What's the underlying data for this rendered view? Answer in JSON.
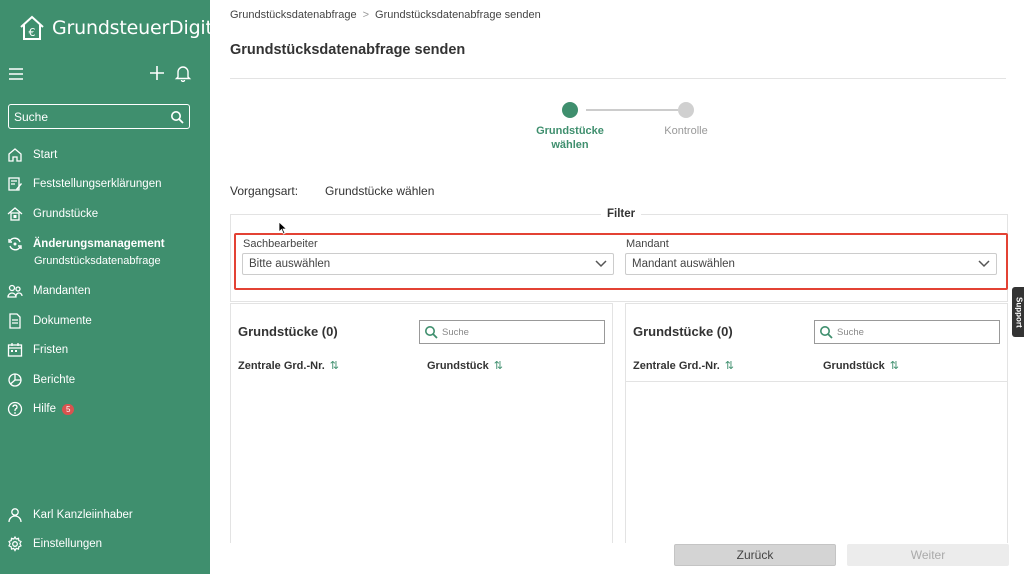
{
  "app": {
    "logo_text": "GrundsteuerDigital"
  },
  "sidebar": {
    "search_label": "Suche",
    "items": [
      {
        "label": "Start",
        "icon": "home-icon"
      },
      {
        "label": "Feststellungserklärungen",
        "icon": "edit-document-icon"
      },
      {
        "label": "Grundstücke",
        "icon": "house-icon"
      },
      {
        "label": "Änderungsmanagement",
        "icon": "refresh-icon",
        "active": true
      },
      {
        "label": "Grundstücksdatenabfrage",
        "sub": true
      },
      {
        "label": "Mandanten",
        "icon": "people-icon"
      },
      {
        "label": "Dokumente",
        "icon": "document-icon"
      },
      {
        "label": "Fristen",
        "icon": "calendar-icon"
      },
      {
        "label": "Berichte",
        "icon": "pie-chart-icon"
      },
      {
        "label": "Hilfe",
        "icon": "help-icon",
        "badge": "5"
      }
    ],
    "user": "Karl Kanzleiinhaber",
    "settings": "Einstellungen"
  },
  "breadcrumb": {
    "parent": "Grundstücksdatenabfrage",
    "separator": ">",
    "current": "Grundstücksdatenabfrage senden"
  },
  "page_title": "Grundstücksdatenabfrage senden",
  "stepper": {
    "step1_line1": "Grundstücke",
    "step1_line2": "wählen",
    "step2": "Kontrolle",
    "active_color": "#3f8f6e",
    "inactive_color": "#cccccc"
  },
  "vorgangsart": {
    "label": "Vorgangsart:",
    "value": "Grundstücke wählen"
  },
  "filter": {
    "title": "Filter",
    "sachbearbeiter_label": "Sachbearbeiter",
    "sachbearbeiter_value": "Bitte auswählen",
    "mandant_label": "Mandant",
    "mandant_value": "Mandant auswählen"
  },
  "panels": {
    "left": {
      "title": "Grundstücke (0)",
      "search_placeholder": "Suche",
      "col1": "Zentrale Grd.-Nr.",
      "col2": "Grundstück"
    },
    "right": {
      "title": "Grundstücke (0)",
      "search_placeholder": "Suche",
      "col1": "Zentrale Grd.-Nr.",
      "col2": "Grundstück"
    }
  },
  "buttons": {
    "back": "Zurück",
    "next": "Weiter"
  },
  "support": "Support",
  "colors": {
    "brand": "#3f8f6e",
    "highlight": "#e34234"
  }
}
